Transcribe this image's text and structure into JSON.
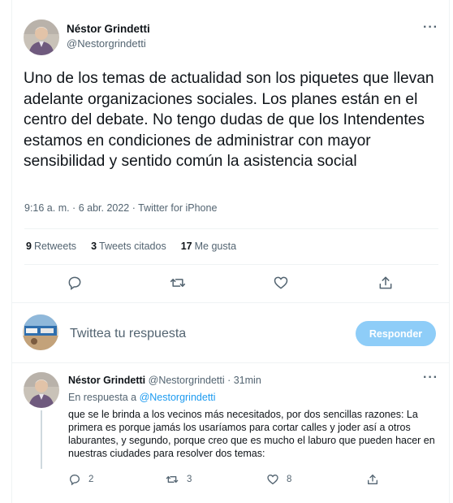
{
  "tweet": {
    "author_name": "Néstor Grindetti",
    "author_handle": "@Nestorgrindetti",
    "more_label": "···",
    "text": "Uno de los temas de actualidad son los piquetes que llevan adelante organizaciones sociales. Los planes están en el centro del debate. No tengo dudas de que los Intendentes  estamos en condiciones de administrar con mayor sensibilidad y sentido común la asistencia social",
    "timestamp": "9:16 a. m. · 6 abr. 2022 · Twitter for iPhone",
    "stats": {
      "retweets_count": "9",
      "retweets_label": "Retweets",
      "quotes_count": "3",
      "quotes_label": "Tweets citados",
      "likes_count": "17",
      "likes_label": "Me gusta"
    }
  },
  "compose": {
    "placeholder": "Twittea tu respuesta",
    "button_label": "Responder"
  },
  "reply": {
    "author_name": "Néstor Grindetti",
    "author_handle_time": "@Nestorgrindetti · 31min",
    "more_label": "···",
    "in_reply_prefix": "En respuesta a ",
    "in_reply_handle": "@Nestorgrindetti",
    "text": "que se le brinda a los vecinos más necesitados, por dos sencillas razones: La primera es porque jamás los usaríamos para cortar calles y joder así a otros laburantes, y segundo, porque creo que es mucho el laburo que pueden hacer en nuestras ciudades para resolver dos temas:",
    "reply_count": "2",
    "retweet_count": "3",
    "like_count": "8"
  },
  "icons": [
    "reply-icon",
    "retweet-icon",
    "like-icon",
    "share-icon",
    "more-icon"
  ],
  "colors": {
    "accent": "#1d9bf0",
    "button_disabled": "#8ecdf8",
    "secondary_text": "#536471",
    "divider": "#eff3f4"
  }
}
